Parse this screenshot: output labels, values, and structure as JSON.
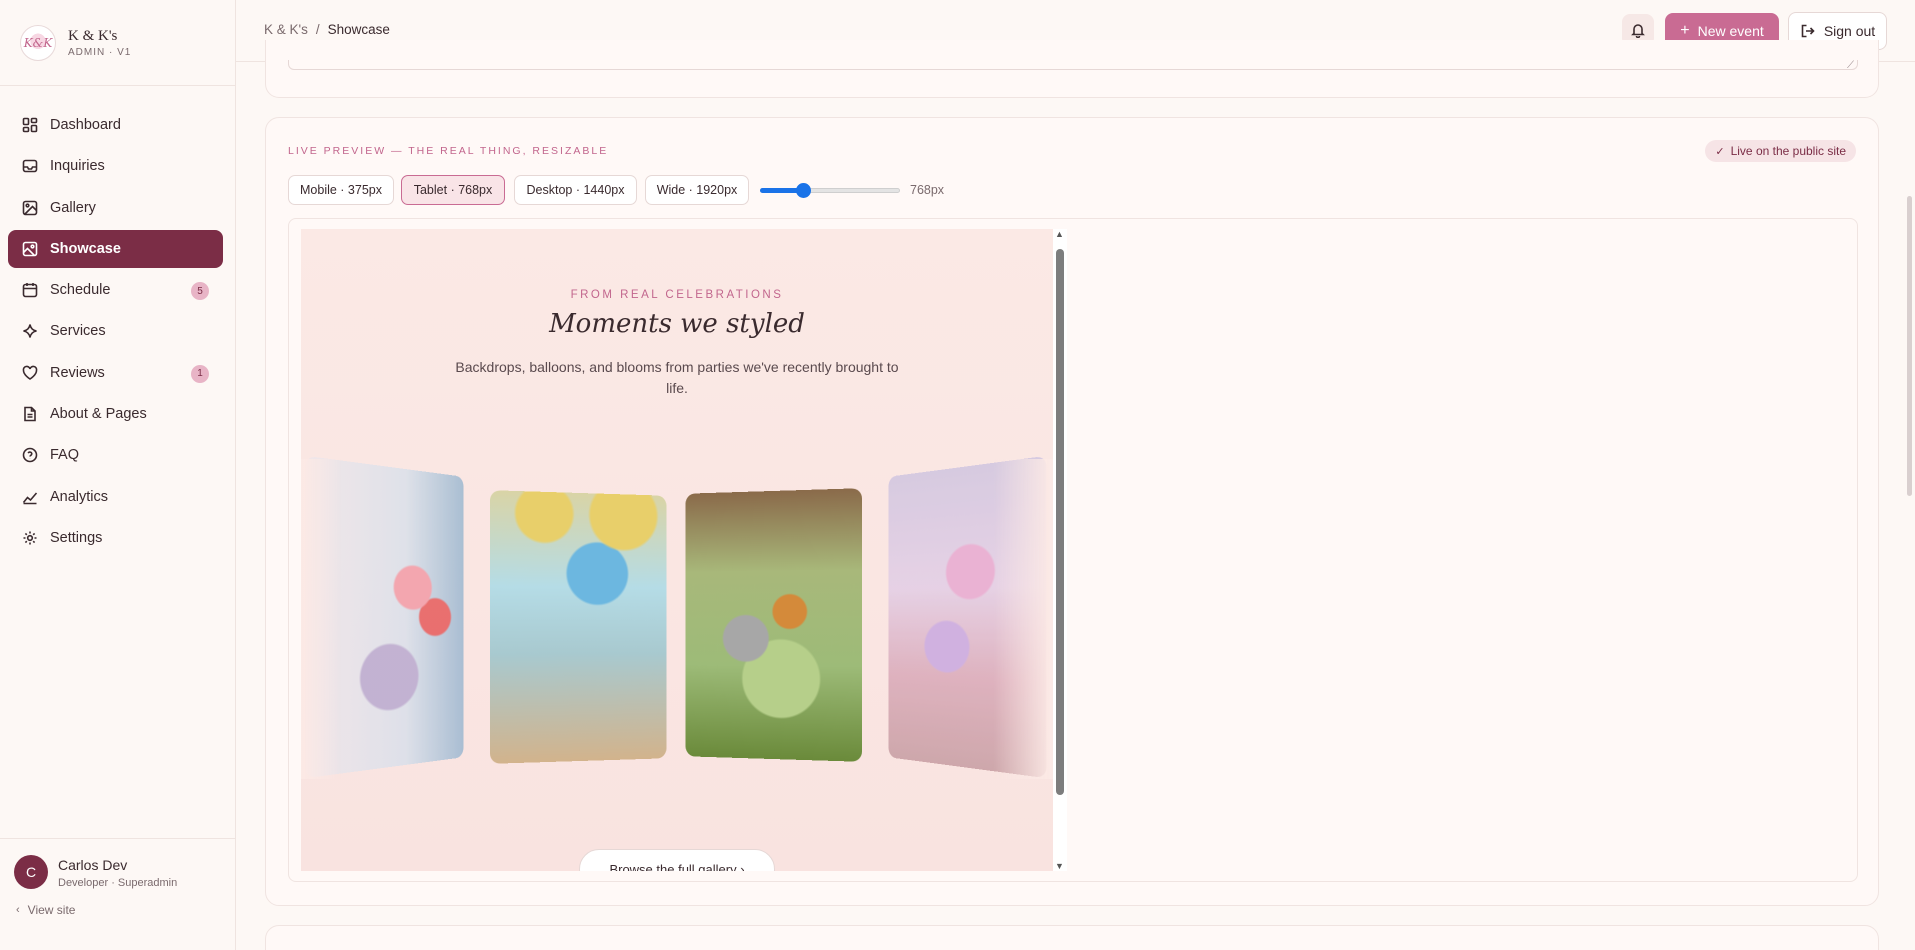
{
  "brand": {
    "name": "K & K's",
    "sub": "ADMIN · V1",
    "logo_text": "K&K"
  },
  "sidebar": {
    "items": [
      {
        "label": "Dashboard",
        "icon": "dashboard-icon"
      },
      {
        "label": "Inquiries",
        "icon": "inbox-icon"
      },
      {
        "label": "Gallery",
        "icon": "image-icon"
      },
      {
        "label": "Showcase",
        "icon": "showcase-icon",
        "active": true
      },
      {
        "label": "Schedule",
        "icon": "calendar-icon",
        "badge": "5"
      },
      {
        "label": "Services",
        "icon": "sparkle-icon"
      },
      {
        "label": "Reviews",
        "icon": "heart-icon",
        "badge": "1"
      },
      {
        "label": "About & Pages",
        "icon": "page-icon"
      },
      {
        "label": "FAQ",
        "icon": "help-circle-icon"
      },
      {
        "label": "Analytics",
        "icon": "chart-icon"
      },
      {
        "label": "Settings",
        "icon": "gear-icon"
      }
    ]
  },
  "user": {
    "initial": "C",
    "name": "Carlos Dev",
    "role": "Developer · Superadmin",
    "view_site": "View site"
  },
  "topbar": {
    "breadcrumb_root": "K & K's",
    "breadcrumb_sep": "/",
    "breadcrumb_current": "Showcase",
    "new_event_label": "New event",
    "sign_out_label": "Sign out"
  },
  "preview": {
    "section_label": "LIVE PREVIEW — THE REAL THING, RESIZABLE",
    "live_label": "Live on the public site",
    "devices": [
      {
        "label": "Mobile · 375px"
      },
      {
        "label": "Tablet · 768px",
        "active": true
      },
      {
        "label": "Desktop · 1440px"
      },
      {
        "label": "Wide · 1920px"
      }
    ],
    "width_readout": "768px",
    "slider_fraction": 0.29,
    "accent_color": "#c96b93",
    "active_nav_color": "#7b2d46"
  },
  "site": {
    "eyebrow": "FROM REAL CELEBRATIONS",
    "title": "Moments we styled",
    "intro": "Backdrops, balloons, and blooms from parties we've recently brought to life.",
    "browse_label": "Browse the full gallery ›"
  }
}
